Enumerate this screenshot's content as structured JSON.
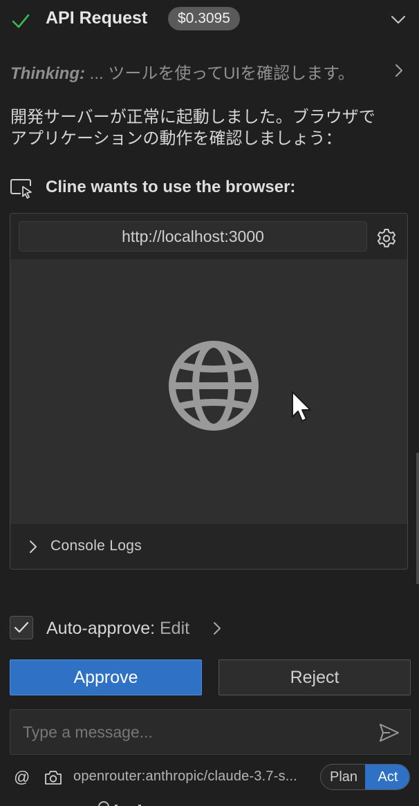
{
  "header": {
    "title": "API Request",
    "cost": "$0.3095",
    "status_icon": "check-icon",
    "collapse_icon": "chevron-down-icon"
  },
  "thinking": {
    "label": "Thinking:",
    "text": " ... ツールを使ってUIを確認します。"
  },
  "message": {
    "line1": "開発サーバーが正常に起動しました。ブラウザで",
    "line2": "アプリケーションの動作を確認しましょう："
  },
  "browser": {
    "heading": "Cline wants to use the browser:",
    "url": "http://localhost:3000",
    "console_label": "Console Logs"
  },
  "auto_approve": {
    "label": "Auto-approve:",
    "value": " Edit",
    "checked": true
  },
  "actions": {
    "approve": "Approve",
    "reject": "Reject"
  },
  "input": {
    "placeholder": "Type a message..."
  },
  "footer": {
    "at_symbol": "@",
    "model": "openrouter:anthropic/claude-3.7-s...",
    "mode_plan": "Plan",
    "mode_act": "Act",
    "active_mode": "Act"
  },
  "colors": {
    "background": "#1f1f1f",
    "accent": "#2f72c5",
    "success": "#3fb950"
  }
}
